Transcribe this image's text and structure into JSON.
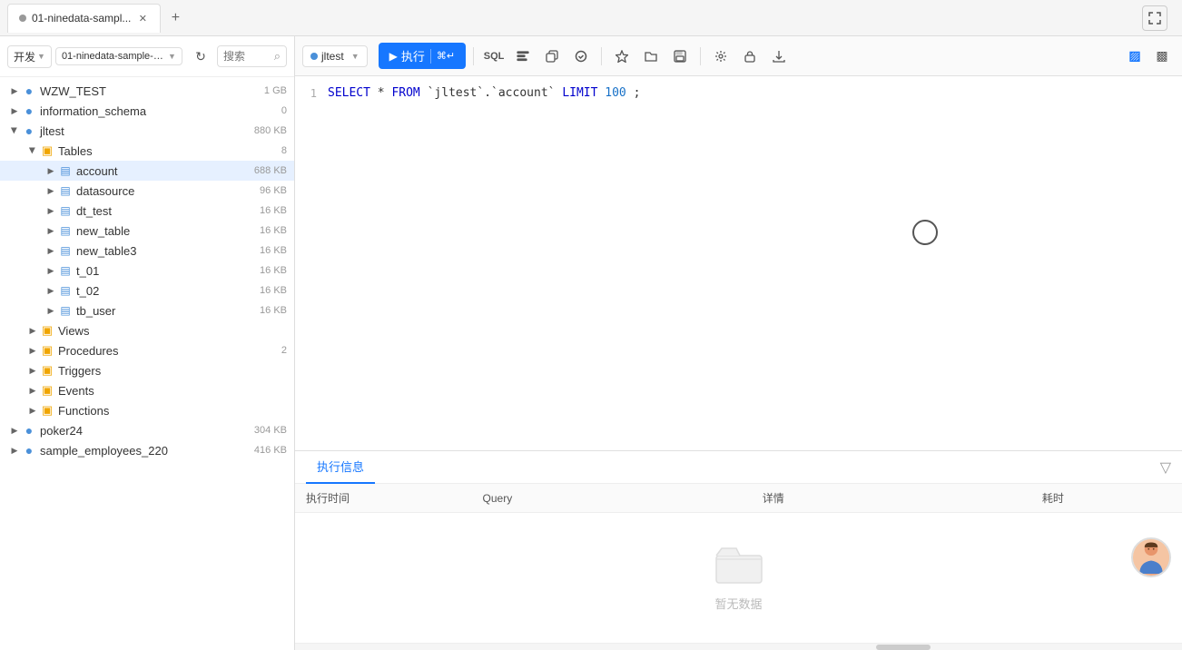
{
  "tab": {
    "title": "01-ninedata-sampl...",
    "dot_color": "#999"
  },
  "toolbar_top": {
    "fullscreen_label": "⛶"
  },
  "sidebar": {
    "header": {
      "view_label": "开发",
      "db_name": "01-ninedata-sample-data...",
      "search_placeholder": "搜索"
    },
    "tree": [
      {
        "id": "wzw_test",
        "label": "WZW_TEST",
        "size": "1 GB",
        "level": 0,
        "type": "db",
        "open": false
      },
      {
        "id": "information_schema",
        "label": "information_schema",
        "size": "0",
        "level": 0,
        "type": "db",
        "open": false
      },
      {
        "id": "jltest",
        "label": "jltest",
        "size": "880 KB",
        "level": 0,
        "type": "db",
        "open": true
      },
      {
        "id": "tables",
        "label": "Tables",
        "badge": "8",
        "level": 1,
        "type": "folder",
        "open": true
      },
      {
        "id": "account",
        "label": "account",
        "size": "688 KB",
        "level": 2,
        "type": "table",
        "open": false,
        "selected": true
      },
      {
        "id": "datasource",
        "label": "datasource",
        "size": "96 KB",
        "level": 2,
        "type": "table",
        "open": false
      },
      {
        "id": "dt_test",
        "label": "dt_test",
        "size": "16 KB",
        "level": 2,
        "type": "table",
        "open": false
      },
      {
        "id": "new_table",
        "label": "new_table",
        "size": "16 KB",
        "level": 2,
        "type": "table",
        "open": false
      },
      {
        "id": "new_table3",
        "label": "new_table3",
        "size": "16 KB",
        "level": 2,
        "type": "table",
        "open": false
      },
      {
        "id": "t_01",
        "label": "t_01",
        "size": "16 KB",
        "level": 2,
        "type": "table",
        "open": false
      },
      {
        "id": "t_02",
        "label": "t_02",
        "size": "16 KB",
        "level": 2,
        "type": "table",
        "open": false
      },
      {
        "id": "tb_user",
        "label": "tb_user",
        "size": "16 KB",
        "level": 2,
        "type": "table",
        "open": false
      },
      {
        "id": "views",
        "label": "Views",
        "level": 1,
        "type": "folder",
        "open": false
      },
      {
        "id": "procedures",
        "label": "Procedures",
        "badge": "2",
        "level": 1,
        "type": "folder",
        "open": false
      },
      {
        "id": "triggers",
        "label": "Triggers",
        "level": 1,
        "type": "folder",
        "open": false
      },
      {
        "id": "events",
        "label": "Events",
        "level": 1,
        "type": "folder",
        "open": false
      },
      {
        "id": "functions",
        "label": "Functions",
        "level": 1,
        "type": "folder",
        "open": false
      },
      {
        "id": "poker24",
        "label": "poker24",
        "size": "304 KB",
        "level": 0,
        "type": "db",
        "open": false
      },
      {
        "id": "sample_employees_220",
        "label": "sample_employees_220",
        "size": "416 KB",
        "level": 0,
        "type": "db",
        "open": false
      }
    ]
  },
  "editor": {
    "db_selector": "jltest",
    "run_button": "执行",
    "run_shortcut": "⌘↵",
    "code": "SELECT * FROM `jltest`.`account` LIMIT 100;",
    "line_number": "1"
  },
  "bottom_panel": {
    "tab_label": "执行信息",
    "columns": [
      "执行时间",
      "Query",
      "详情",
      "耗时"
    ],
    "empty_text": "暂无数据"
  }
}
